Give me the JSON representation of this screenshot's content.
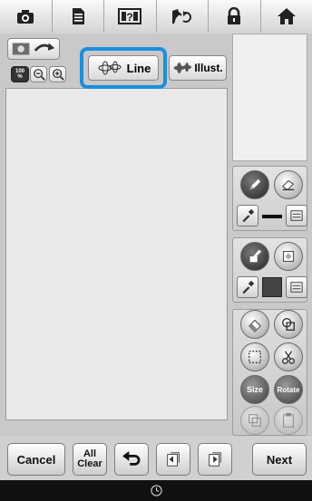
{
  "toolbar": {
    "items": [
      "camera-icon",
      "document-icon",
      "question-icon",
      "scanner-icon",
      "lock-icon",
      "home-icon"
    ],
    "question_glyph": "?"
  },
  "view_controls": {
    "zoom_label": "100\n%"
  },
  "modes": {
    "line_label": "Line",
    "illust_label": "Illust."
  },
  "tools": {
    "size_label": "Size",
    "rotate_label": "Rotate"
  },
  "bottom": {
    "cancel_label": "Cancel",
    "all_clear_label": "All\nClear",
    "next_label": "Next"
  }
}
